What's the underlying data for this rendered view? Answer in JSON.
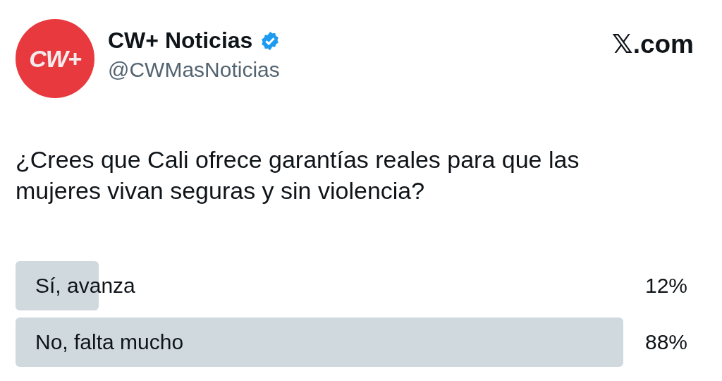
{
  "account": {
    "logo_text": "CW+",
    "name": "CW+ Noticias",
    "verified": true,
    "handle": "@CWMasNoticias"
  },
  "site": "𝕏.com",
  "question": "¿Crees que Cali ofrece garantías reales para que las mujeres vivan seguras y sin violencia?",
  "poll": {
    "options": [
      {
        "label": "Sí, avanza",
        "percent": "12%"
      },
      {
        "label": "No, falta mucho",
        "percent": "88%"
      }
    ]
  }
}
